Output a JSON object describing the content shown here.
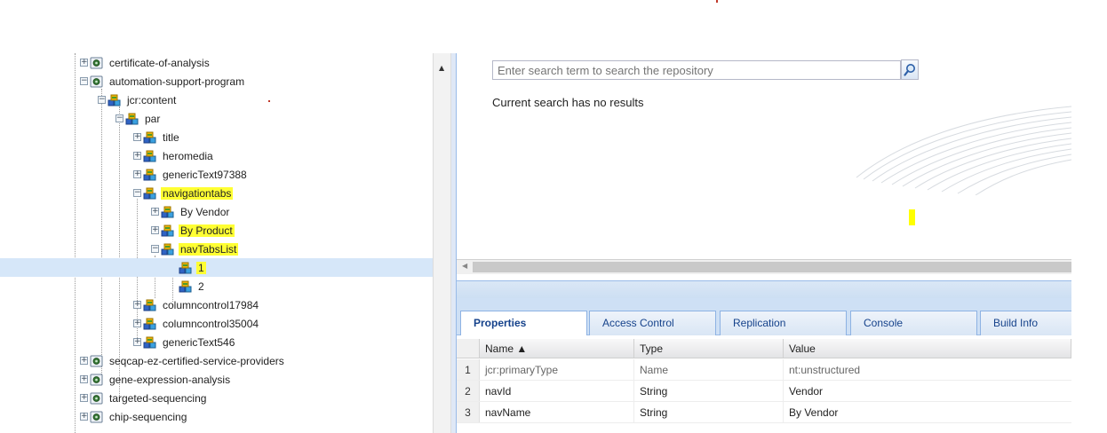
{
  "tree": {
    "nodes": [
      {
        "label": "certificate-of-analysis",
        "toggle": "+",
        "icon": "page-icon"
      },
      {
        "label": "automation-support-program",
        "toggle": "−",
        "icon": "page-icon"
      },
      {
        "label": "jcr:content",
        "toggle": "−",
        "icon": "node-icon"
      },
      {
        "label": "par",
        "toggle": "−",
        "icon": "node-icon"
      },
      {
        "label": "title",
        "toggle": "+",
        "icon": "node-icon"
      },
      {
        "label": "heromedia",
        "toggle": "+",
        "icon": "node-icon"
      },
      {
        "label": "genericText97388",
        "toggle": "+",
        "icon": "node-icon"
      },
      {
        "label": "navigationtabs",
        "toggle": "−",
        "icon": "node-icon",
        "highlight": true
      },
      {
        "label": "By Vendor",
        "toggle": "+",
        "icon": "node-icon"
      },
      {
        "label": "By Product",
        "toggle": "+",
        "icon": "node-icon",
        "highlight": true
      },
      {
        "label": "navTabsList",
        "toggle": "−",
        "icon": "node-icon",
        "highlight": true
      },
      {
        "label": "1",
        "toggle": "",
        "icon": "node-icon",
        "highlight": true,
        "selected": true
      },
      {
        "label": "2",
        "toggle": "",
        "icon": "node-icon"
      },
      {
        "label": "columncontrol17984",
        "toggle": "+",
        "icon": "node-icon"
      },
      {
        "label": "columncontrol35004",
        "toggle": "+",
        "icon": "node-icon"
      },
      {
        "label": "genericText546",
        "toggle": "+",
        "icon": "node-icon"
      },
      {
        "label": "seqcap-ez-certified-service-providers",
        "toggle": "+",
        "icon": "page-icon"
      },
      {
        "label": "gene-expression-analysis",
        "toggle": "+",
        "icon": "page-icon"
      },
      {
        "label": "targeted-sequencing",
        "toggle": "+",
        "icon": "page-icon"
      },
      {
        "label": "chip-sequencing",
        "toggle": "+",
        "icon": "page-icon"
      }
    ]
  },
  "search": {
    "placeholder": "Enter search term to search the repository",
    "no_results": "Current search has no results"
  },
  "tabs": [
    "Properties",
    "Access Control",
    "Replication",
    "Console",
    "Build Info"
  ],
  "active_tab": "Properties",
  "grid": {
    "headers": {
      "name": "Name ▲",
      "type": "Type",
      "value": "Value"
    },
    "rows": [
      {
        "num": "1",
        "name": "jcr:primaryType",
        "type": "Name",
        "value": "nt:unstructured",
        "muted": true
      },
      {
        "num": "2",
        "name": "navId",
        "type": "String",
        "value": "Vendor"
      },
      {
        "num": "3",
        "name": "navName",
        "type": "String",
        "value": "By Vendor"
      }
    ]
  },
  "colors": {
    "highlight": "#ffff33",
    "selected_row": "#d6e7f9",
    "tab_text": "#15428b"
  }
}
